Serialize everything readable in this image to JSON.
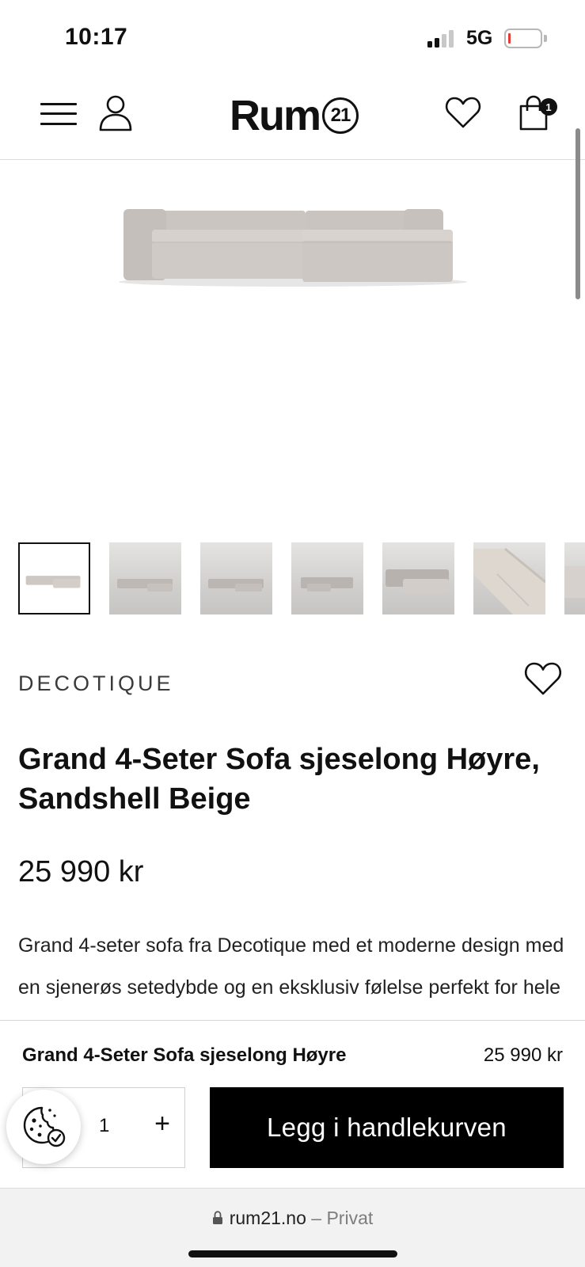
{
  "status_bar": {
    "time": "10:17",
    "network": "5G",
    "battery_color": "#e53935"
  },
  "header": {
    "logo_text": "Rum",
    "logo_number": "21",
    "cart_count": "1",
    "icons": [
      "menu-icon",
      "account-icon",
      "heart-icon",
      "shopping-bag-icon"
    ]
  },
  "gallery": {
    "thumbnail_count": 7,
    "active_index": 0
  },
  "product": {
    "brand": "DECOTIQUE",
    "title": "Grand 4-Seter Sofa sjeselong Høyre, Sandshell Beige",
    "price": "25 990 kr",
    "description": "Grand 4-seter sofa fra Decotique med et moderne design med en sjenerøs setedybde og en eksklusiv følelse perfekt for hele familien å bruke sammen i"
  },
  "sticky_cart": {
    "name": "Grand 4-Seter Sofa sjeselong Høyre",
    "price": "25 990 kr",
    "quantity": "1",
    "plus_label": "+",
    "button_label": "Legg i handlekurven"
  },
  "browser": {
    "domain": "rum21.no",
    "mode": "– Privat"
  },
  "colors": {
    "accent": "#000000",
    "sofa": "#cdc8c3"
  }
}
